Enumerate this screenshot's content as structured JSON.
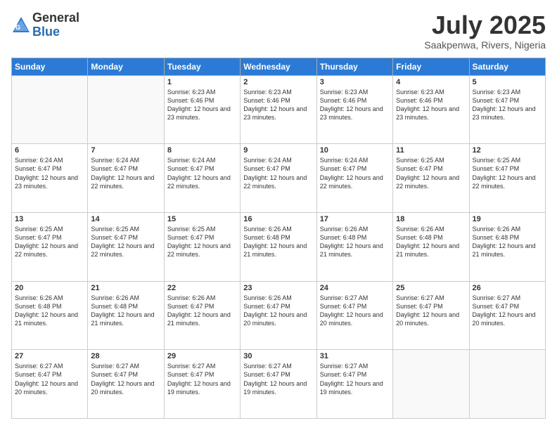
{
  "header": {
    "logo_general": "General",
    "logo_blue": "Blue",
    "month_title": "July 2025",
    "subtitle": "Saakpenwa, Rivers, Nigeria"
  },
  "weekdays": [
    "Sunday",
    "Monday",
    "Tuesday",
    "Wednesday",
    "Thursday",
    "Friday",
    "Saturday"
  ],
  "weeks": [
    [
      {
        "day": "",
        "info": ""
      },
      {
        "day": "",
        "info": ""
      },
      {
        "day": "1",
        "info": "Sunrise: 6:23 AM\nSunset: 6:46 PM\nDaylight: 12 hours and 23 minutes."
      },
      {
        "day": "2",
        "info": "Sunrise: 6:23 AM\nSunset: 6:46 PM\nDaylight: 12 hours and 23 minutes."
      },
      {
        "day": "3",
        "info": "Sunrise: 6:23 AM\nSunset: 6:46 PM\nDaylight: 12 hours and 23 minutes."
      },
      {
        "day": "4",
        "info": "Sunrise: 6:23 AM\nSunset: 6:46 PM\nDaylight: 12 hours and 23 minutes."
      },
      {
        "day": "5",
        "info": "Sunrise: 6:23 AM\nSunset: 6:47 PM\nDaylight: 12 hours and 23 minutes."
      }
    ],
    [
      {
        "day": "6",
        "info": "Sunrise: 6:24 AM\nSunset: 6:47 PM\nDaylight: 12 hours and 23 minutes."
      },
      {
        "day": "7",
        "info": "Sunrise: 6:24 AM\nSunset: 6:47 PM\nDaylight: 12 hours and 22 minutes."
      },
      {
        "day": "8",
        "info": "Sunrise: 6:24 AM\nSunset: 6:47 PM\nDaylight: 12 hours and 22 minutes."
      },
      {
        "day": "9",
        "info": "Sunrise: 6:24 AM\nSunset: 6:47 PM\nDaylight: 12 hours and 22 minutes."
      },
      {
        "day": "10",
        "info": "Sunrise: 6:24 AM\nSunset: 6:47 PM\nDaylight: 12 hours and 22 minutes."
      },
      {
        "day": "11",
        "info": "Sunrise: 6:25 AM\nSunset: 6:47 PM\nDaylight: 12 hours and 22 minutes."
      },
      {
        "day": "12",
        "info": "Sunrise: 6:25 AM\nSunset: 6:47 PM\nDaylight: 12 hours and 22 minutes."
      }
    ],
    [
      {
        "day": "13",
        "info": "Sunrise: 6:25 AM\nSunset: 6:47 PM\nDaylight: 12 hours and 22 minutes."
      },
      {
        "day": "14",
        "info": "Sunrise: 6:25 AM\nSunset: 6:47 PM\nDaylight: 12 hours and 22 minutes."
      },
      {
        "day": "15",
        "info": "Sunrise: 6:25 AM\nSunset: 6:47 PM\nDaylight: 12 hours and 22 minutes."
      },
      {
        "day": "16",
        "info": "Sunrise: 6:26 AM\nSunset: 6:48 PM\nDaylight: 12 hours and 21 minutes."
      },
      {
        "day": "17",
        "info": "Sunrise: 6:26 AM\nSunset: 6:48 PM\nDaylight: 12 hours and 21 minutes."
      },
      {
        "day": "18",
        "info": "Sunrise: 6:26 AM\nSunset: 6:48 PM\nDaylight: 12 hours and 21 minutes."
      },
      {
        "day": "19",
        "info": "Sunrise: 6:26 AM\nSunset: 6:48 PM\nDaylight: 12 hours and 21 minutes."
      }
    ],
    [
      {
        "day": "20",
        "info": "Sunrise: 6:26 AM\nSunset: 6:48 PM\nDaylight: 12 hours and 21 minutes."
      },
      {
        "day": "21",
        "info": "Sunrise: 6:26 AM\nSunset: 6:48 PM\nDaylight: 12 hours and 21 minutes."
      },
      {
        "day": "22",
        "info": "Sunrise: 6:26 AM\nSunset: 6:47 PM\nDaylight: 12 hours and 21 minutes."
      },
      {
        "day": "23",
        "info": "Sunrise: 6:26 AM\nSunset: 6:47 PM\nDaylight: 12 hours and 20 minutes."
      },
      {
        "day": "24",
        "info": "Sunrise: 6:27 AM\nSunset: 6:47 PM\nDaylight: 12 hours and 20 minutes."
      },
      {
        "day": "25",
        "info": "Sunrise: 6:27 AM\nSunset: 6:47 PM\nDaylight: 12 hours and 20 minutes."
      },
      {
        "day": "26",
        "info": "Sunrise: 6:27 AM\nSunset: 6:47 PM\nDaylight: 12 hours and 20 minutes."
      }
    ],
    [
      {
        "day": "27",
        "info": "Sunrise: 6:27 AM\nSunset: 6:47 PM\nDaylight: 12 hours and 20 minutes."
      },
      {
        "day": "28",
        "info": "Sunrise: 6:27 AM\nSunset: 6:47 PM\nDaylight: 12 hours and 20 minutes."
      },
      {
        "day": "29",
        "info": "Sunrise: 6:27 AM\nSunset: 6:47 PM\nDaylight: 12 hours and 19 minutes."
      },
      {
        "day": "30",
        "info": "Sunrise: 6:27 AM\nSunset: 6:47 PM\nDaylight: 12 hours and 19 minutes."
      },
      {
        "day": "31",
        "info": "Sunrise: 6:27 AM\nSunset: 6:47 PM\nDaylight: 12 hours and 19 minutes."
      },
      {
        "day": "",
        "info": ""
      },
      {
        "day": "",
        "info": ""
      }
    ]
  ]
}
